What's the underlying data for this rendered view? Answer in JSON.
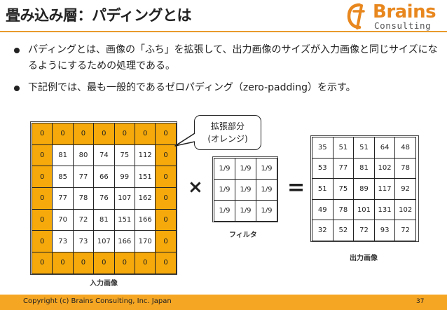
{
  "header": {
    "title": "畳み込み層：パディングとは",
    "logo_text": "Brains",
    "logo_sub": "Consulting"
  },
  "bullets": [
    "パディングとは、画像の「ふち」を拡張して、出力画像のサイズが入力画像と同じサイズになるようにするための処理である。",
    "下記例では、最も一般的であるゼロパディング（zero-padding）を示す。"
  ],
  "input_matrix": [
    [
      "0",
      "0",
      "0",
      "0",
      "0",
      "0",
      "0"
    ],
    [
      "0",
      "81",
      "80",
      "74",
      "75",
      "112",
      "0"
    ],
    [
      "0",
      "85",
      "77",
      "66",
      "99",
      "151",
      "0"
    ],
    [
      "0",
      "77",
      "78",
      "76",
      "107",
      "162",
      "0"
    ],
    [
      "0",
      "70",
      "72",
      "81",
      "151",
      "166",
      "0"
    ],
    [
      "0",
      "73",
      "73",
      "107",
      "166",
      "170",
      "0"
    ],
    [
      "0",
      "0",
      "0",
      "0",
      "0",
      "0",
      "0"
    ]
  ],
  "filter_matrix": [
    [
      "1/9",
      "1/9",
      "1/9"
    ],
    [
      "1/9",
      "1/9",
      "1/9"
    ],
    [
      "1/9",
      "1/9",
      "1/9"
    ]
  ],
  "output_matrix": [
    [
      "35",
      "51",
      "51",
      "64",
      "48"
    ],
    [
      "53",
      "77",
      "81",
      "102",
      "78"
    ],
    [
      "51",
      "75",
      "89",
      "117",
      "92"
    ],
    [
      "49",
      "78",
      "101",
      "131",
      "102"
    ],
    [
      "32",
      "52",
      "72",
      "93",
      "72"
    ]
  ],
  "captions": {
    "input": "入力画像",
    "filter": "フィルタ",
    "output": "出力画像"
  },
  "operators": {
    "times": "×",
    "equals": "="
  },
  "callout": {
    "line1": "拡張部分",
    "line2": "(オレンジ)"
  },
  "footer": {
    "copyright": "Copyright (c) Brains Consulting, Inc. Japan",
    "page": "37"
  },
  "colors": {
    "accent": "#f5a623",
    "padding_fill": "#f5a90a",
    "logo_orange": "#e8871e"
  }
}
